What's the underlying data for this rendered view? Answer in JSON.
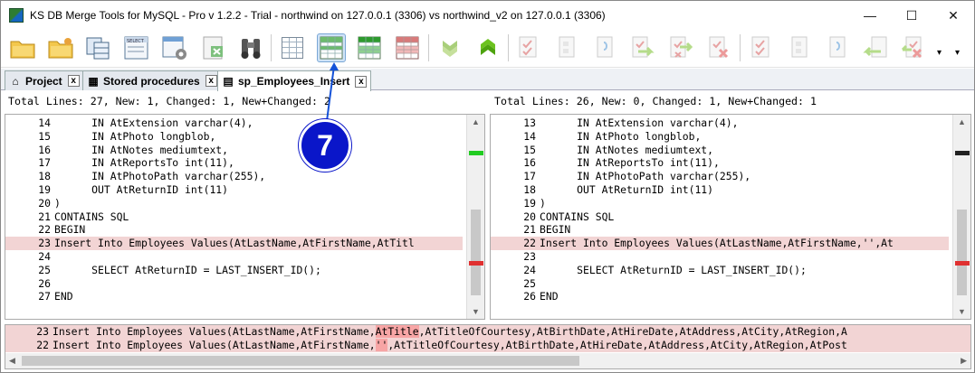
{
  "window": {
    "title": "KS DB Merge Tools for MySQL - Pro v 1.2.2 - Trial - northwind on 127.0.0.1 (3306) vs northwind_v2 on 127.0.0.1 (3306)",
    "minimize": "—",
    "maximize": "☐",
    "close": "✕"
  },
  "toolbar": {
    "icons": [
      "open-folder-icon",
      "open-folder-star-icon",
      "compare-tables-icon",
      "select-query-icon",
      "schema-settings-icon",
      "export-excel-icon",
      "binoculars-icon",
      "grid-all-icon",
      "grid-changed-icon",
      "grid-new-icon",
      "grid-removed-icon",
      "next-diff-icon",
      "prev-diff-icon",
      "merge-left-icon",
      "merge-doc-icon",
      "copy-doc-icon",
      "copy-right-icon",
      "delete-right-icon",
      "select-left-icon",
      "blank-doc-icon",
      "copy-doc-2-icon",
      "copy-left-icon",
      "delete-left-icon"
    ],
    "overflow": "▾"
  },
  "tabs": [
    {
      "label": "Project",
      "icon": "⌂",
      "close": "x"
    },
    {
      "label": "Stored procedures",
      "icon": "▦",
      "close": "x"
    },
    {
      "label": "sp_Employees_Insert",
      "icon": "▤",
      "close": "x"
    }
  ],
  "left": {
    "stats": "Total Lines: 27, New: 1, Changed: 1, New+Changed: 2",
    "lines": [
      {
        "n": "14",
        "t": "      IN AtExtension varchar(4),",
        "c": false
      },
      {
        "n": "15",
        "t": "      IN AtPhoto longblob,",
        "c": false
      },
      {
        "n": "16",
        "t": "      IN AtNotes mediumtext,",
        "c": false
      },
      {
        "n": "17",
        "t": "      IN AtReportsTo int(11),",
        "c": false
      },
      {
        "n": "18",
        "t": "      IN AtPhotoPath varchar(255),",
        "c": false
      },
      {
        "n": "19",
        "t": "      OUT AtReturnID int(11)",
        "c": false
      },
      {
        "n": "20",
        "t": ")",
        "c": false
      },
      {
        "n": "21",
        "t": "CONTAINS SQL",
        "c": false
      },
      {
        "n": "22",
        "t": "BEGIN",
        "c": false
      },
      {
        "n": "23",
        "t": "Insert Into Employees Values(AtLastName,AtFirstName,AtTitl",
        "c": true
      },
      {
        "n": "24",
        "t": "",
        "c": false
      },
      {
        "n": "25",
        "t": "      SELECT AtReturnID = LAST_INSERT_ID();",
        "c": false
      },
      {
        "n": "26",
        "t": "",
        "c": false
      },
      {
        "n": "27",
        "t": "END",
        "c": false
      }
    ]
  },
  "right": {
    "stats": "Total Lines: 26, New: 0, Changed: 1, New+Changed: 1",
    "lines": [
      {
        "n": "13",
        "t": "      IN AtExtension varchar(4),",
        "c": false
      },
      {
        "n": "14",
        "t": "      IN AtPhoto longblob,",
        "c": false
      },
      {
        "n": "15",
        "t": "      IN AtNotes mediumtext,",
        "c": false
      },
      {
        "n": "16",
        "t": "      IN AtReportsTo int(11),",
        "c": false
      },
      {
        "n": "17",
        "t": "      IN AtPhotoPath varchar(255),",
        "c": false
      },
      {
        "n": "18",
        "t": "      OUT AtReturnID int(11)",
        "c": false
      },
      {
        "n": "19",
        "t": ")",
        "c": false
      },
      {
        "n": "20",
        "t": "CONTAINS SQL",
        "c": false
      },
      {
        "n": "21",
        "t": "BEGIN",
        "c": false
      },
      {
        "n": "22",
        "t": "Insert Into Employees Values(AtLastName,AtFirstName,'',At",
        "c": true
      },
      {
        "n": "23",
        "t": "",
        "c": false
      },
      {
        "n": "24",
        "t": "      SELECT AtReturnID = LAST_INSERT_ID();",
        "c": false
      },
      {
        "n": "25",
        "t": "",
        "c": false
      },
      {
        "n": "26",
        "t": "END",
        "c": false
      }
    ]
  },
  "bottom": [
    {
      "n": "23",
      "pre": "Insert Into Employees Values(AtLastName,AtFirstName,",
      "hl": "AtTitle",
      "post": ",AtTitleOfCourtesy,AtBirthDate,AtHireDate,AtAddress,AtCity,AtRegion,A"
    },
    {
      "n": "22",
      "pre": "Insert Into Employees Values(AtLastName,AtFirstName,",
      "hl": "''",
      "post": ",AtTitleOfCourtesy,AtBirthDate,AtHireDate,AtAddress,AtCity,AtRegion,AtPost"
    }
  ],
  "callout": "7",
  "colors": {
    "changed_line": "#f2d4d4",
    "highlight": "#f7a5a5",
    "new_marker": "#22cc22",
    "changed_marker": "#e03030",
    "callout": "#0a16c9"
  }
}
